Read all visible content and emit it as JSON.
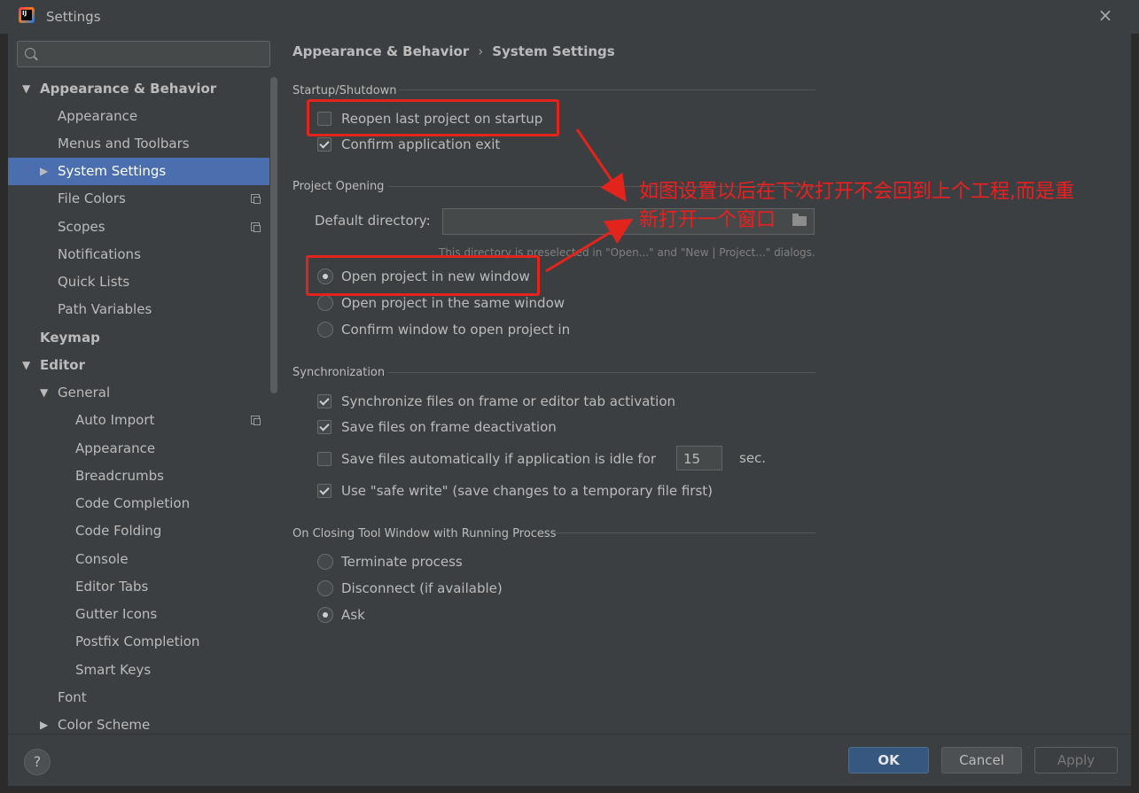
{
  "window": {
    "title": "Settings",
    "close_glyph": "×"
  },
  "sidebar": {
    "search_placeholder": "",
    "items": [
      {
        "label": "Appearance & Behavior",
        "level": 0,
        "expanded": true,
        "bold": true
      },
      {
        "label": "Appearance",
        "level": 1
      },
      {
        "label": "Menus and Toolbars",
        "level": 1
      },
      {
        "label": "System Settings",
        "level": 1,
        "collapsed": true,
        "selected": true
      },
      {
        "label": "File Colors",
        "level": 1,
        "copy_icon": true
      },
      {
        "label": "Scopes",
        "level": 1,
        "copy_icon": true
      },
      {
        "label": "Notifications",
        "level": 1
      },
      {
        "label": "Quick Lists",
        "level": 1
      },
      {
        "label": "Path Variables",
        "level": 1
      },
      {
        "label": "Keymap",
        "level": 0,
        "bold": true
      },
      {
        "label": "Editor",
        "level": 0,
        "expanded": true,
        "bold": true
      },
      {
        "label": "General",
        "level": 1,
        "expanded": true
      },
      {
        "label": "Auto Import",
        "level": 2,
        "copy_icon": true
      },
      {
        "label": "Appearance",
        "level": 2
      },
      {
        "label": "Breadcrumbs",
        "level": 2
      },
      {
        "label": "Code Completion",
        "level": 2
      },
      {
        "label": "Code Folding",
        "level": 2
      },
      {
        "label": "Console",
        "level": 2
      },
      {
        "label": "Editor Tabs",
        "level": 2
      },
      {
        "label": "Gutter Icons",
        "level": 2
      },
      {
        "label": "Postfix Completion",
        "level": 2
      },
      {
        "label": "Smart Keys",
        "level": 2
      },
      {
        "label": "Font",
        "level": 1
      },
      {
        "label": "Color Scheme",
        "level": 1,
        "collapsed": true
      }
    ]
  },
  "breadcrumb": {
    "parent": "Appearance & Behavior",
    "separator": "›",
    "current": "System Settings"
  },
  "startup": {
    "title": "Startup/Shutdown",
    "reopen_label": "Reopen last project on startup",
    "reopen_checked": false,
    "confirm_exit_label": "Confirm application exit",
    "confirm_exit_checked": true
  },
  "project_opening": {
    "title": "Project Opening",
    "default_dir_label": "Default directory:",
    "default_dir_value": "",
    "hint": "This directory is preselected in \"Open...\" and \"New | Project...\" dialogs.",
    "options": [
      {
        "label": "Open project in new window",
        "selected": true
      },
      {
        "label": "Open project in the same window",
        "selected": false
      },
      {
        "label": "Confirm window to open project in",
        "selected": false
      }
    ]
  },
  "sync": {
    "title": "Synchronization",
    "sync_files_label": "Synchronize files on frame or editor tab activation",
    "save_on_deactivation_label": "Save files on frame deactivation",
    "save_idle_label": "Save files automatically if application is idle for",
    "idle_value": "15",
    "idle_unit": "sec.",
    "safe_write_label": "Use \"safe write\" (save changes to a temporary file first)"
  },
  "closing": {
    "title": "On Closing Tool Window with Running Process",
    "options": [
      {
        "label": "Terminate process",
        "selected": false
      },
      {
        "label": "Disconnect (if available)",
        "selected": false
      },
      {
        "label": "Ask",
        "selected": true
      }
    ]
  },
  "annotation": {
    "line1": "如图设置以后在下次打开不会回到上个工程,而是重",
    "line2": "新打开一个窗口",
    "color": "#e3241c"
  },
  "footer": {
    "help": "?",
    "ok": "OK",
    "cancel": "Cancel",
    "apply": "Apply"
  },
  "colors": {
    "background": "#3c3f41",
    "selection": "#4b6eaf",
    "ok_button": "#365880"
  }
}
